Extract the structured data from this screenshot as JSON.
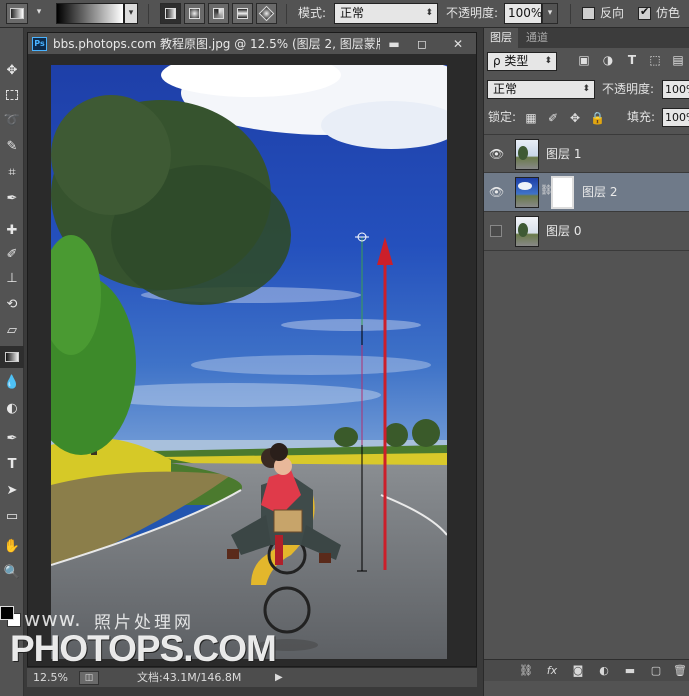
{
  "options_bar": {
    "mode_label": "模式:",
    "mode_value": "正常",
    "opacity_label": "不透明度:",
    "opacity_value": "100%",
    "reverse_label": "反向",
    "reverse_checked": false,
    "dither_label": "仿色",
    "dither_checked": true
  },
  "document": {
    "app_badge": "Ps",
    "title": "bbs.photops.com 教程原图.jpg @ 12.5% (图层 2, 图层蒙版...",
    "zoom": "12.5%",
    "doc_info": "文档:43.1M/146.8M",
    "window_buttons": {
      "minimize": "▬",
      "maximize": "◻",
      "close": "✕"
    }
  },
  "watermark": {
    "line1": "www.",
    "line1b": "照片处理网",
    "line2": "PHOTOPS.COM"
  },
  "panel": {
    "tabs": [
      {
        "label": "图层",
        "active": true
      },
      {
        "label": "通道",
        "active": false
      }
    ],
    "filter_kind": "ρ 类型",
    "blend_mode": "正常",
    "opacity_label": "不透明度:",
    "opacity_value": "100%",
    "lock_label": "锁定:",
    "fill_label": "填充:",
    "fill_value": "100%",
    "layers": [
      {
        "name": "图层 1",
        "visible": true,
        "selected": false,
        "has_mask": false
      },
      {
        "name": "图层 2",
        "visible": true,
        "selected": true,
        "has_mask": true
      },
      {
        "name": "图层 0",
        "visible": false,
        "selected": false,
        "has_mask": false
      }
    ],
    "footer_icons": [
      "link-icon",
      "fx-icon",
      "mask-icon",
      "adjustment-icon",
      "group-icon",
      "new-layer-icon",
      "trash-icon"
    ]
  },
  "toolbox": {
    "tools": [
      "move",
      "marquee",
      "lasso",
      "quick-select",
      "crop",
      "eyedropper",
      "healing",
      "brush",
      "clone-stamp",
      "history-brush",
      "eraser",
      "gradient",
      "blur",
      "dodge",
      "pen",
      "type",
      "path-select",
      "shape",
      "hand",
      "zoom"
    ],
    "active_tool": "gradient"
  },
  "colors": {
    "accent_arrow": "#cc1f2a",
    "selected_layer": "#6f7a89"
  }
}
